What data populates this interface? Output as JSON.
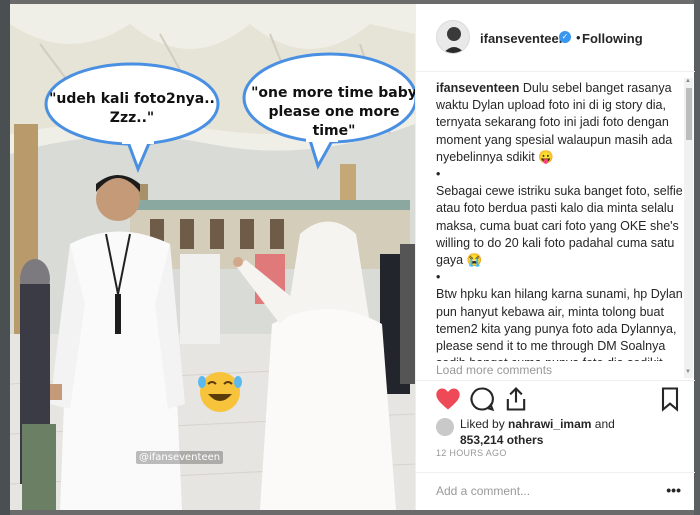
{
  "post": {
    "bubble1": "\"udeh kali foto2nya.. Zzz..\"",
    "bubble2": "\"one more time baby please one more time\"",
    "tag": "@ifanseventeen"
  },
  "header": {
    "username": "ifanseventeen",
    "separator": "•",
    "follow_label": "Following"
  },
  "caption": {
    "username": "ifanseventeen",
    "para1": "Dulu sebel banget rasanya waktu Dylan upload foto ini di ig story dia, ternyata sekarang foto ini jadi foto dengan moment yang spesial walaupun masih ada nyebelinnya sdikit 😛",
    "bullet1": "•",
    "para2": "Sebagai cewe istriku suka banget foto, selfie atau foto berdua pasti kalo dia minta selalu maksa, cuma buat cari foto yang OKE she's willing to do 20 kali foto padahal cuma satu gaya 😭",
    "bullet2": "•",
    "para3": "Btw hpku kan hilang karna sunami, hp Dylan pun hanyut kebawa air, minta tolong buat temen2 kita yang punya foto ada Dylannya, please send it to me through DM Soalnya sedih banget cuma punya foto dia sedikit, makasih",
    "load_more": "Load more comments"
  },
  "likes": {
    "prefix": "Liked by",
    "user": "nahrawi_imam",
    "mid": "and",
    "count": "853,214 others"
  },
  "time": "12 HOURS AGO",
  "comment": {
    "placeholder": "Add a comment...",
    "more": "•••"
  },
  "icons": [
    "heart-icon",
    "comment-icon",
    "share-icon",
    "bookmark-icon",
    "verified-icon",
    "laughing-emoji-icon"
  ],
  "colors": {
    "like": "#ed4956",
    "verified": "#3897f0",
    "bubble_stroke": "#4a90e2"
  }
}
